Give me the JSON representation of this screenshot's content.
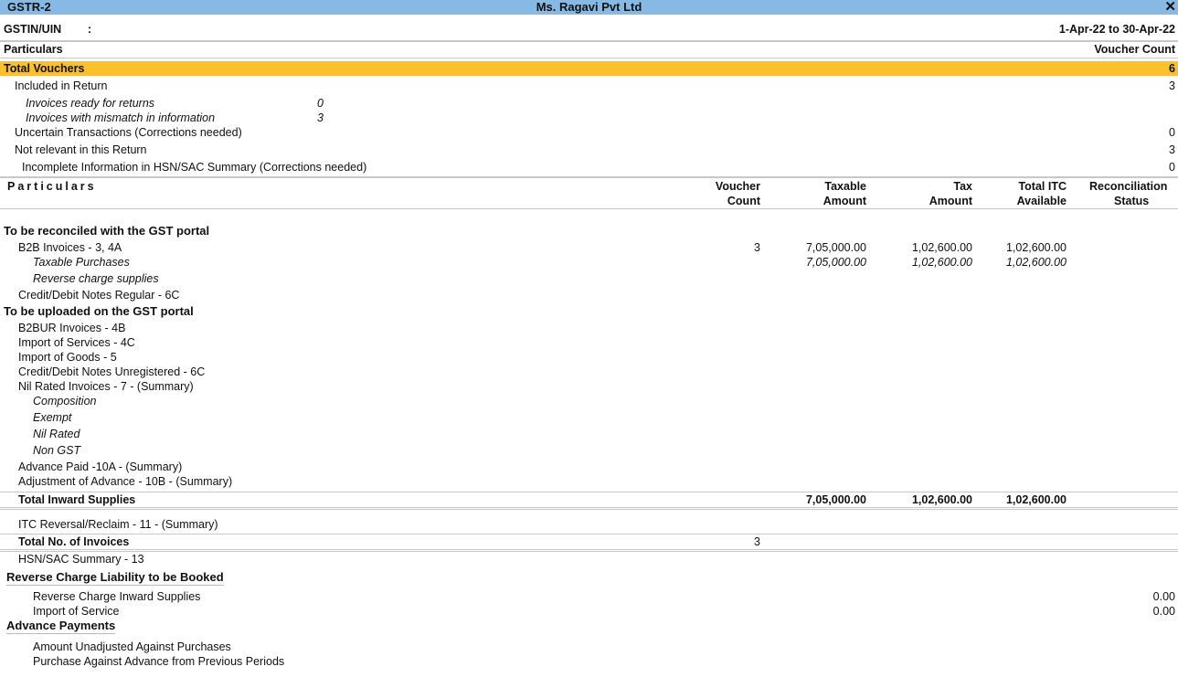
{
  "window": {
    "report_name": "GSTR-2",
    "company": "Ms. Ragavi Pvt Ltd",
    "close_icon": "close-icon"
  },
  "header": {
    "gstin_label": "GSTIN/UIN",
    "gstin_sep": ":",
    "period": "1-Apr-22 to 30-Apr-22"
  },
  "summary": {
    "col_particulars": "Particulars",
    "col_count": "Voucher Count",
    "total_vouchers": {
      "label": "Total Vouchers",
      "value": "6"
    },
    "included": {
      "label": "Included in Return",
      "value": "3"
    },
    "ready": {
      "label": "Invoices ready for returns",
      "value": "0"
    },
    "mismatch": {
      "label": "Invoices with mismatch in information",
      "value": "3"
    },
    "uncertain": {
      "label": "Uncertain Transactions (Corrections needed)",
      "value": "0"
    },
    "not_relevant": {
      "label": "Not relevant in this Return",
      "value": "3"
    },
    "incomplete_hsn": {
      "label": "Incomplete Information in HSN/SAC Summary (Corrections needed)",
      "value": "0"
    }
  },
  "table": {
    "headers": {
      "particulars": "Particulars",
      "voucher_count_1": "Voucher",
      "voucher_count_2": "Count",
      "taxable_1": "Taxable",
      "taxable_2": "Amount",
      "tax_1": "Tax",
      "tax_2": "Amount",
      "itc_1": "Total ITC",
      "itc_2": "Available",
      "recon_1": "Reconciliation",
      "recon_2": "Status"
    },
    "reconcile_heading": "To be reconciled with the GST portal",
    "b2b": {
      "label": "B2B Invoices - 3, 4A",
      "count": "3",
      "taxable": "7,05,000.00",
      "tax": "1,02,600.00",
      "itc": "1,02,600.00"
    },
    "taxable_purchases": {
      "label": "Taxable Purchases",
      "taxable": "7,05,000.00",
      "tax": "1,02,600.00",
      "itc": "1,02,600.00"
    },
    "reverse_charge": "Reverse charge supplies",
    "cdn_regular": "Credit/Debit Notes Regular - 6C",
    "upload_heading": "To be uploaded on the GST portal",
    "b2bur": "B2BUR Invoices - 4B",
    "import_services": "Import of Services - 4C",
    "import_goods": "Import of Goods - 5",
    "cdn_unreg": "Credit/Debit Notes Unregistered - 6C",
    "nil_rated_inv": "Nil Rated Invoices - 7 - (Summary)",
    "composition": "Composition",
    "exempt": "Exempt",
    "nil_rated": "Nil Rated",
    "non_gst": "Non GST",
    "advance_paid": "Advance Paid -10A - (Summary)",
    "adjust_advance": "Adjustment of Advance - 10B - (Summary)",
    "total_inward": {
      "label": "Total Inward Supplies",
      "taxable": "7,05,000.00",
      "tax": "1,02,600.00",
      "itc": "1,02,600.00"
    },
    "itc_reversal": "ITC Reversal/Reclaim - 11 - (Summary)",
    "total_invoices": {
      "label": "Total No. of Invoices",
      "count": "3"
    },
    "hsn_summary": "HSN/SAC Summary - 13"
  },
  "reverse_liability": {
    "heading": "Reverse Charge Liability to be Booked",
    "rc_inward": {
      "label": "Reverse Charge Inward Supplies",
      "value": "0.00"
    },
    "import_service": {
      "label": "Import of Service",
      "value": "0.00"
    }
  },
  "advance_payments": {
    "heading": "Advance Payments",
    "unadjusted": "Amount Unadjusted Against Purchases",
    "prev_periods": "Purchase Against Advance from Previous Periods"
  }
}
